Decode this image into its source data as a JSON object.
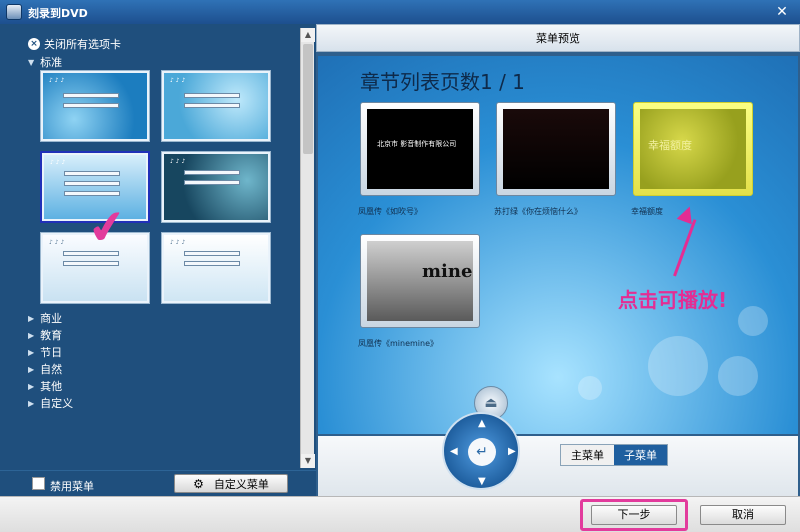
{
  "window": {
    "title": "刻录到DVD",
    "close_glyph": "✕"
  },
  "left": {
    "close_all_tabs": "关闭所有选项卡",
    "categories": {
      "standard": "标准",
      "business": "商业",
      "education": "教育",
      "holiday": "节日",
      "nature": "自然",
      "other": "其他",
      "custom": "自定义"
    },
    "disable_menu": "禁用菜单",
    "custom_menu_button": "自定义菜单"
  },
  "preview": {
    "header": "菜单预览",
    "chapter_title": "章节列表页数1 / 1",
    "chapters": [
      {
        "label": "凤凰传《如吹号》",
        "thumb_text": "北京市 影音制作有限公司"
      },
      {
        "label": "苏打绿《你在烦恼什么》",
        "thumb_text": ""
      },
      {
        "label": "幸福额度",
        "thumb_text": "幸福额度"
      },
      {
        "label": "凤凰传《minemine》",
        "thumb_text": "mine"
      }
    ],
    "hint": "点击可播放!",
    "eject_glyph": "⏏"
  },
  "nav": {
    "ok_glyph": "↵",
    "tabs": {
      "main_menu": "主菜单",
      "sub_menu": "子菜单"
    }
  },
  "footer": {
    "next": "下一步",
    "cancel": "取消"
  },
  "colors": {
    "highlight": "#e23b9c",
    "accent": "#1f5f9f"
  }
}
